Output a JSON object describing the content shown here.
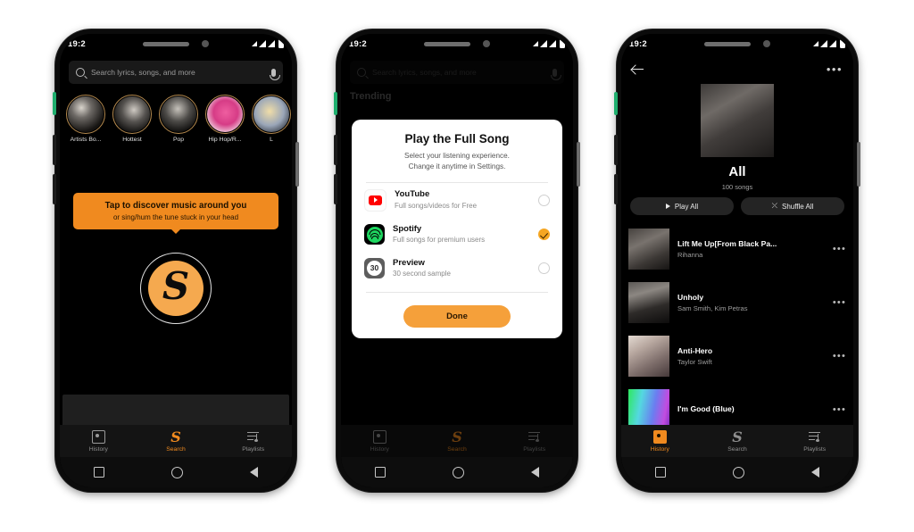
{
  "colors": {
    "accent_orange": "#f08a1f",
    "accent_orange_light": "#f5a94f",
    "spotify_green": "#1ed760",
    "youtube_red": "#ff0000",
    "app_bg": "#000000",
    "page_bg": "#ffffff"
  },
  "status_bar": {
    "time": "19:2",
    "signal_icon": "signal-bars-icon",
    "battery_icon": "battery-icon"
  },
  "android_nav": {
    "recents": "recents-square-icon",
    "home": "home-circle-icon",
    "back": "back-triangle-icon"
  },
  "phone1": {
    "label": "shazam-search-home",
    "search": {
      "placeholder": "Search lyrics, songs, and more",
      "search_icon": "search-icon",
      "mic_icon": "microphone-icon"
    },
    "stories": [
      {
        "label": "Artists Bo..."
      },
      {
        "label": "Hottest"
      },
      {
        "label": "Pop"
      },
      {
        "label": "Hip Hop/R..."
      },
      {
        "label": "L"
      }
    ],
    "tap_banner": {
      "line1": "Tap to discover music around you",
      "line2": "or sing/hum the tune stuck in your head"
    },
    "shazam_button": {
      "glyph": "S",
      "name": "shazam-listen-button"
    },
    "bottom_nav": [
      {
        "label": "History",
        "icon": "history-icon",
        "active": false
      },
      {
        "label": "Search",
        "icon": "shazam-s-icon",
        "active": true
      },
      {
        "label": "Playlists",
        "icon": "playlists-icon",
        "active": false
      }
    ]
  },
  "phone2": {
    "label": "play-full-song-dialog",
    "search": {
      "placeholder": "Search lyrics, songs, and more",
      "search_icon": "search-icon",
      "mic_icon": "microphone-icon"
    },
    "background_heading": "Trending",
    "dialog": {
      "title": "Play the Full Song",
      "subtitle_line1": "Select your listening experience.",
      "subtitle_line2": "Change it anytime in Settings.",
      "options": [
        {
          "name": "YouTube",
          "description": "Full songs/videos for Free",
          "icon": "youtube-icon",
          "selected": false
        },
        {
          "name": "Spotify",
          "description": "Full songs for premium users",
          "icon": "spotify-icon",
          "selected": true
        },
        {
          "name": "Preview",
          "description": "30 second sample",
          "icon": "preview-30-icon",
          "badge": "30",
          "selected": false
        }
      ],
      "done_label": "Done"
    },
    "bottom_nav": [
      {
        "label": "History",
        "icon": "history-icon",
        "active": false
      },
      {
        "label": "Search",
        "icon": "shazam-s-icon",
        "active": true
      },
      {
        "label": "Playlists",
        "icon": "playlists-icon",
        "active": false
      }
    ]
  },
  "phone3": {
    "label": "playlist-detail-all",
    "top_bar": {
      "back_icon": "back-arrow-icon",
      "overflow_icon": "more-options-icon"
    },
    "playlist": {
      "cover_art": "rihanna-lift-me-up-cover",
      "title": "All",
      "song_count": "100 songs",
      "play_all_label": "Play All",
      "shuffle_all_label": "Shuffle All",
      "play_icon": "play-triangle-icon",
      "shuffle_icon": "shuffle-icon"
    },
    "tracks": [
      {
        "title": "Lift Me Up[From Black Pa...",
        "artist": "Rihanna",
        "art": "rihanna-cover"
      },
      {
        "title": "Unholy",
        "artist": "Sam Smith, Kim Petras",
        "art": "unholy-cover"
      },
      {
        "title": "Anti-Hero",
        "artist": "Taylor Swift",
        "art": "midnights-cover"
      },
      {
        "title": "I'm Good (Blue)",
        "artist": "",
        "art": "im-good-cover"
      }
    ],
    "bottom_nav": [
      {
        "label": "History",
        "icon": "history-icon",
        "active": true
      },
      {
        "label": "Search",
        "icon": "shazam-s-icon",
        "active": false
      },
      {
        "label": "Playlists",
        "icon": "playlists-icon",
        "active": false
      }
    ]
  }
}
